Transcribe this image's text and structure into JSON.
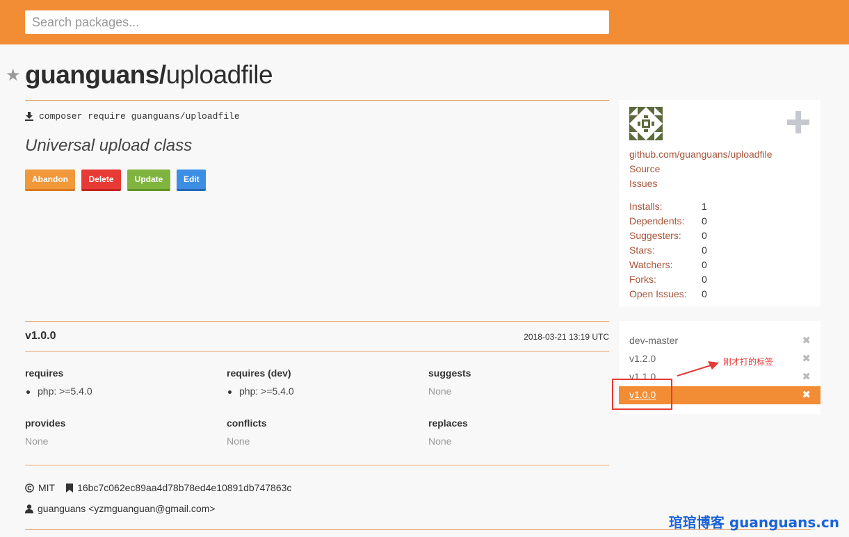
{
  "search": {
    "placeholder": "Search packages..."
  },
  "package": {
    "vendor": "guanguans/",
    "name": "uploadfile",
    "require_cmd": "composer require guanguans/uploadfile",
    "description": "Universal upload class"
  },
  "buttons": {
    "abandon": "Abandon",
    "delete": "Delete",
    "update": "Update",
    "edit": "Edit"
  },
  "sidebar": {
    "repo_link": "github.com/guanguans/uploadfile",
    "source": "Source",
    "issues": "Issues",
    "stats": [
      {
        "label": "Installs:",
        "value": "1"
      },
      {
        "label": "Dependents:",
        "value": "0"
      },
      {
        "label": "Suggesters:",
        "value": "0"
      },
      {
        "label": "Stars:",
        "value": "0"
      },
      {
        "label": "Watchers:",
        "value": "0"
      },
      {
        "label": "Forks:",
        "value": "0"
      },
      {
        "label": "Open Issues:",
        "value": "0"
      }
    ]
  },
  "versions": [
    {
      "label": "dev-master",
      "active": false
    },
    {
      "label": "v1.2.0",
      "active": false
    },
    {
      "label": "v1.1.0",
      "active": false
    },
    {
      "label": "v1.0.0",
      "active": true
    }
  ],
  "annotation": "刚才打的标签",
  "version_detail": {
    "version": "v1.0.0",
    "date": "2018-03-21 13:19 UTC",
    "requires": {
      "title": "requires",
      "items": [
        "php: >=5.4.0"
      ]
    },
    "requires_dev": {
      "title": "requires (dev)",
      "items": [
        "php: >=5.4.0"
      ]
    },
    "suggests": {
      "title": "suggests",
      "none": "None"
    },
    "provides": {
      "title": "provides",
      "none": "None"
    },
    "conflicts": {
      "title": "conflicts",
      "none": "None"
    },
    "replaces": {
      "title": "replaces",
      "none": "None"
    },
    "license": "MIT",
    "commit": "16bc7c062ec89aa4d78b78ed4e10891db747863c",
    "author": "guanguans <yzmguanguan@gmail.com>"
  },
  "watermark": "琯琯博客 guanguans.cn",
  "colors": {
    "accent": "#f28d35",
    "link": "#a8553a",
    "annotation": "#e53935",
    "watermark": "#1b63d8"
  }
}
